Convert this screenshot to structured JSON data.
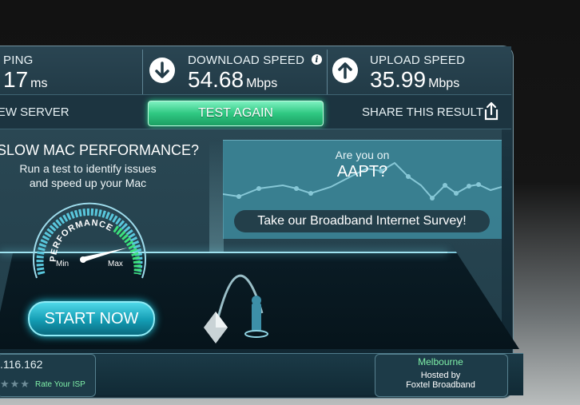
{
  "stats": {
    "ping": {
      "label": "PING",
      "value": "17",
      "unit": "ms"
    },
    "download": {
      "label": "DOWNLOAD SPEED",
      "value": "54.68",
      "unit": "Mbps"
    },
    "upload": {
      "label": "UPLOAD SPEED",
      "value": "35.99",
      "unit": "Mbps"
    }
  },
  "actions": {
    "new_server": "NEW SERVER",
    "test_again": "TEST AGAIN",
    "share": "SHARE THIS RESULT"
  },
  "promo": {
    "title": "SLOW MAC PERFORMANCE?",
    "subtitle_line1": "Run a test to identify issues",
    "subtitle_line2": "and speed up your Mac",
    "gauge_label": "PERFORMANCE",
    "gauge_min": "Min",
    "gauge_max": "Max",
    "start_now": "START NOW"
  },
  "survey": {
    "question": "Are you on",
    "isp": "AAPT?",
    "button": "Take our Broadband Internet Survey!"
  },
  "client": {
    "ip": ".116.162",
    "rate_isp": "Rate Your ISP",
    "stars": "★★★"
  },
  "server": {
    "city": "Melbourne",
    "hosted_by": "Hosted by",
    "host": "Foxtel Broadband"
  },
  "icons": {
    "download": "arrow-down-circle-icon",
    "upload": "arrow-up-circle-icon",
    "info": "info-icon",
    "share": "share-icon"
  },
  "colors": {
    "accent_green": "#2fc882",
    "accent_cyan": "#139cb3",
    "panel": "#223b47"
  }
}
